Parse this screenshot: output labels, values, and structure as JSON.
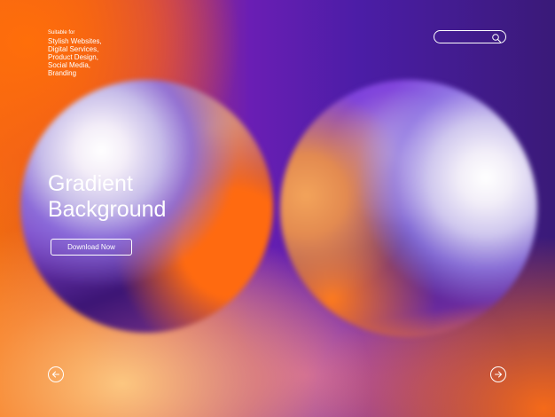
{
  "intro": {
    "label": "Suitable for",
    "lines": [
      "Stylish Websites,",
      "Digital Services,",
      "Product Design,",
      "Social Media,",
      "Branding"
    ]
  },
  "search": {
    "icon": "search-icon"
  },
  "hero": {
    "title_line1": "Gradient",
    "title_line2": "Background",
    "button_label": "Download Now"
  },
  "nav": {
    "prev_icon": "arrow-left-icon",
    "next_icon": "arrow-right-icon"
  },
  "colors": {
    "orange": "#f06a12",
    "purple": "#4b1da6",
    "white": "#ffffff"
  }
}
